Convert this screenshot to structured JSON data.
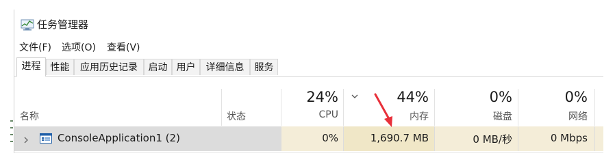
{
  "window": {
    "title": "任务管理器"
  },
  "menu": [
    "文件(F)",
    "选项(O)",
    "查看(V)"
  ],
  "tabs": [
    "进程",
    "性能",
    "应用历史记录",
    "启动",
    "用户",
    "详细信息",
    "服务"
  ],
  "active_tab": "进程",
  "columns": {
    "name": "名称",
    "status": "状态",
    "cpu": {
      "label": "CPU",
      "percent": "24%"
    },
    "memory": {
      "label": "内存",
      "percent": "44%"
    },
    "disk": {
      "label": "磁盘",
      "percent": "0%"
    },
    "network": {
      "label": "网络",
      "percent": "0%"
    }
  },
  "process": {
    "name": "ConsoleApplication1 (2)",
    "status": "",
    "cpu": "0%",
    "memory": "1,690.7 MB",
    "disk": "0 MB/秒",
    "network": "0 Mbps"
  },
  "colors": {
    "highlight_row": "#dcdcdc",
    "usage_cell": "#f4edd8",
    "annotation_arrow": "#e8303a"
  },
  "icons": [
    "task-manager-icon",
    "sort-chevron-icon",
    "expand-chevron-icon",
    "console-app-icon"
  ]
}
